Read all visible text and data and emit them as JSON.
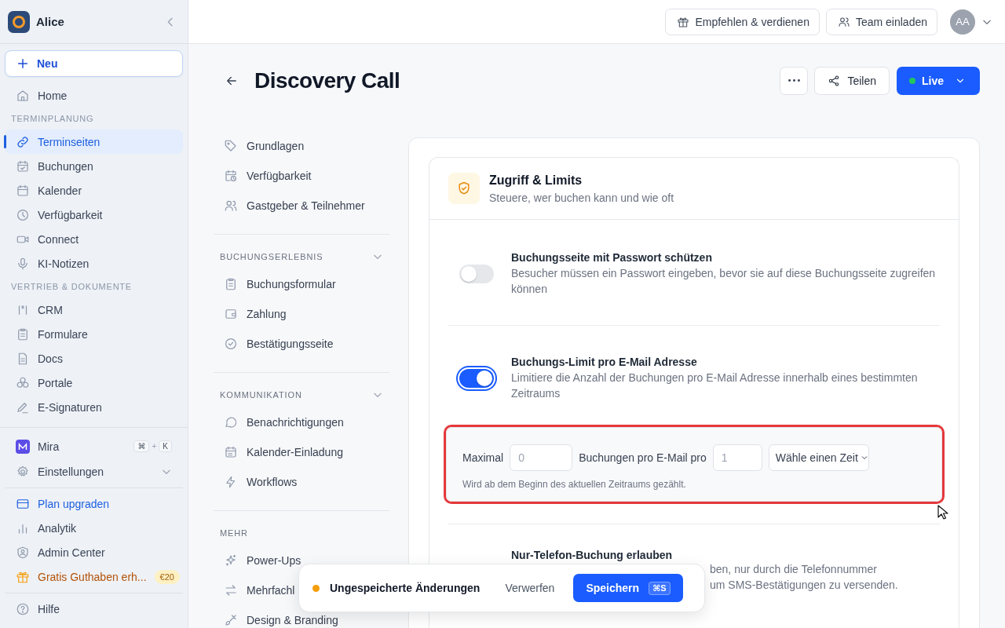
{
  "sidebar": {
    "workspace": "Alice",
    "new_button": "Neu",
    "nav": [
      {
        "kind": "item",
        "label": "Home",
        "selected": false
      },
      {
        "kind": "section",
        "label": "TERMINPLANUNG"
      },
      {
        "kind": "item",
        "label": "Terminseiten",
        "selected": true
      },
      {
        "kind": "item",
        "label": "Buchungen",
        "selected": false
      },
      {
        "kind": "item",
        "label": "Kalender",
        "selected": false
      },
      {
        "kind": "item",
        "label": "Verfügbarkeit",
        "selected": false
      },
      {
        "kind": "item",
        "label": "Connect",
        "selected": false
      },
      {
        "kind": "item",
        "label": "KI-Notizen",
        "selected": false
      },
      {
        "kind": "section",
        "label": "VERTRIEB & DOKUMENTE"
      },
      {
        "kind": "item",
        "label": "CRM",
        "selected": false
      },
      {
        "kind": "item",
        "label": "Formulare",
        "selected": false
      },
      {
        "kind": "item",
        "label": "Docs",
        "selected": false
      },
      {
        "kind": "item",
        "label": "Portale",
        "selected": false
      },
      {
        "kind": "item",
        "label": "E-Signaturen",
        "selected": false
      }
    ],
    "bottom_groups": [
      {
        "items": [
          {
            "kind": "assistant",
            "label": "Mira",
            "shortcut": {
              "keys": [
                "⌘",
                "K"
              ],
              "joiner": "+"
            }
          },
          {
            "kind": "expandable",
            "label": "Einstellungen",
            "expanded": false
          }
        ]
      },
      {
        "items": [
          {
            "kind": "upgrade",
            "label": "Plan upgraden"
          },
          {
            "kind": "item",
            "label": "Analytik"
          },
          {
            "kind": "item",
            "label": "Admin Center"
          },
          {
            "kind": "promo",
            "label": "Gratis Guthaben erh...",
            "badge": "€20"
          }
        ]
      },
      {
        "items": [
          {
            "kind": "item",
            "label": "Hilfe"
          }
        ]
      }
    ]
  },
  "topbar": {
    "buttons": [
      "Empfehlen & verdienen",
      "Team einladen"
    ],
    "avatar": "AA"
  },
  "page": {
    "title": "Discovery Call",
    "share": "Teilen",
    "status": {
      "label": "Live",
      "live": true
    }
  },
  "subnav": [
    {
      "items": [
        "Grundlagen",
        "Verfügbarkeit",
        "Gastgeber & Teilnehmer"
      ]
    },
    {
      "title": "BUCHUNGSERLEBNIS",
      "expanded": true,
      "items": [
        "Buchungsformular",
        "Zahlung",
        "Bestätigungsseite"
      ]
    },
    {
      "title": "KOMMUNIKATION",
      "expanded": true,
      "items": [
        "Benachrichtigungen",
        "Kalender-Einladung",
        "Workflows"
      ]
    },
    {
      "title": "MEHR",
      "items": [
        "Power-Ups",
        "Mehrfachl",
        "Design & Branding"
      ]
    }
  ],
  "panel": {
    "title": "Zugriff & Limits",
    "subtitle": "Steuere, wer buchen kann und wie oft",
    "settings": [
      {
        "title": "Buchungsseite mit Passwort schützen",
        "description": "Besucher müssen ein Passwort eingeben, bevor sie auf diese Buchungsseite zugreifen können",
        "on": false,
        "focused": false
      },
      {
        "title": "Buchungs-Limit pro E-Mail Adresse",
        "description": "Limitiere die Anzahl der Buchungen pro E-Mail Adresse innerhalb eines bestimmten Zeitraums",
        "on": true,
        "focused": true,
        "limit": {
          "highlighted": true,
          "label_before": "Maximal",
          "max": {
            "placeholder": "0"
          },
          "label_middle": "Buchungen pro E-Mail pro",
          "count": {
            "placeholder": "1"
          },
          "period": {
            "value": "Wähle einen Zeit"
          },
          "hint": "Wird ab dem Beginn des aktuellen Zeitraums gezählt."
        }
      },
      {
        "title": "Nur-Telefon-Buchung erlauben",
        "description_fragments": [
          "ben, nur durch die Telefonnummer",
          "um SMS-Bestätigungen zu versenden."
        ]
      }
    ]
  },
  "toast": {
    "message": "Ungespeicherte Änderungen",
    "discard": "Verwerfen",
    "save": "Speichern",
    "shortcut": "⌘S"
  }
}
